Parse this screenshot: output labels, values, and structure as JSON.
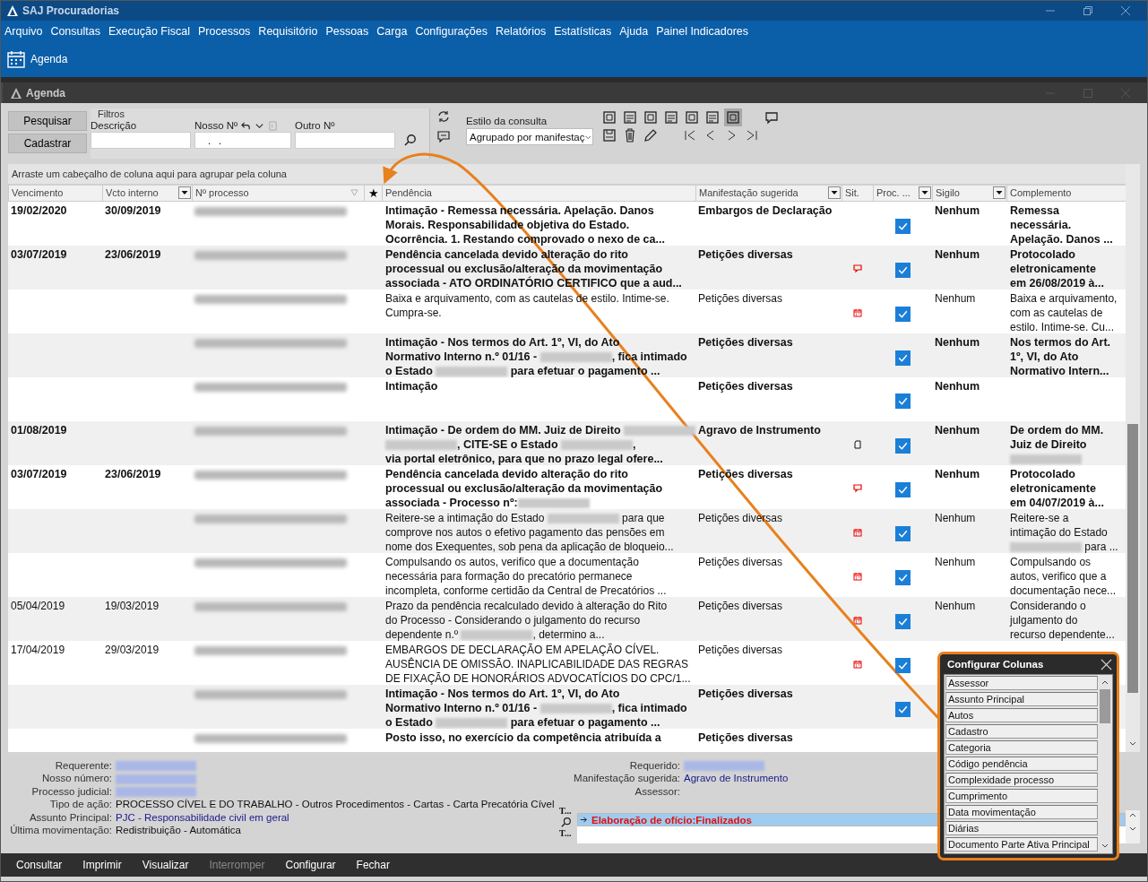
{
  "app": {
    "title": "SAJ Procuradorias"
  },
  "menu": [
    "Arquivo",
    "Consultas",
    "Execução Fiscal",
    "Processos",
    "Requisitório",
    "Pessoas",
    "Carga",
    "Configurações",
    "Relatórios",
    "Estatísticas",
    "Ajuda",
    "Painel Indicadores"
  ],
  "ribbon": [
    {
      "label": "Agenda"
    }
  ],
  "window": {
    "title": "Agenda"
  },
  "filters": {
    "buttons": [
      "Pesquisar",
      "Cadastrar"
    ],
    "group_label": "Filtros",
    "fields": [
      {
        "label": "Descrição"
      },
      {
        "label": "Nosso Nº",
        "value": ". ."
      },
      {
        "label": "Outro Nº"
      }
    ],
    "style_label": "Estilo da consulta",
    "style_value": "Agrupado por manifestaç"
  },
  "table": {
    "group_hint": "Arraste um cabeçalho de coluna aqui para agrupar pela coluna",
    "columns": [
      {
        "label": "Vencimento",
        "kind": "plain"
      },
      {
        "label": "Vcto interno",
        "kind": "dropdown"
      },
      {
        "label": "Nº processo",
        "kind": "filter"
      },
      {
        "label": "★",
        "kind": "plain"
      },
      {
        "label": "Pendência",
        "kind": "plain"
      },
      {
        "label": "Manifestação sugerida",
        "kind": "dropdown"
      },
      {
        "label": "Sit.",
        "kind": "plain"
      },
      {
        "label": "Proc. ...",
        "kind": "dropdown"
      },
      {
        "label": "Sigilo",
        "kind": "dropdown"
      },
      {
        "label": "Complemento",
        "kind": "plain"
      }
    ],
    "rows": [
      {
        "due": "19/02/2020",
        "internal": "30/09/2019",
        "bold": true,
        "pendencia": [
          [
            "Intimação - Remessa necessária. Apelação. Danos"
          ],
          [
            "Morais. Responsabilidade objetiva do Estado."
          ],
          [
            "Ocorrência. 1. Restando comprovado o nexo de ca..."
          ]
        ],
        "manifestacao": "Embargos de Declaração",
        "proc": true,
        "sigilo": "Nenhum",
        "complemento": [
          [
            "Remessa"
          ],
          [
            "necessária."
          ],
          [
            "Apelação. Danos ..."
          ]
        ]
      },
      {
        "due": "03/07/2019",
        "internal": "23/06/2019",
        "bold": true,
        "pendencia": [
          [
            "Pendência cancelada devido alteração do rito"
          ],
          [
            "processual ou exclusão/alteração da movimentação"
          ],
          [
            "associada - ATO ORDINATÓRIO CERTIFICO que a aud..."
          ]
        ],
        "manifestacao": "Petições diversas",
        "sit": {
          "kind": "comment"
        },
        "proc": true,
        "sigilo": "Nenhum",
        "complemento": [
          [
            "Protocolado"
          ],
          [
            "eletronicamente"
          ],
          [
            "em 26/08/2019 à..."
          ]
        ]
      },
      {
        "bold": false,
        "pendencia": [
          [
            "Baixa e arquivamento, com as cautelas de estilo. Intime-se."
          ],
          [
            "Cumpra-se."
          ]
        ],
        "manifestacao": "Petições diversas",
        "sit": {
          "kind": "calendar"
        },
        "proc": true,
        "sigilo": "Nenhum",
        "complemento": [
          [
            "Baixa e arquivamento,"
          ],
          [
            "com as cautelas de"
          ],
          [
            "estilo. Intime-se. Cu..."
          ]
        ]
      },
      {
        "bold": true,
        "pendencia": [
          [
            "Intimação - Nos termos do Art. 1º, VI, do Ato"
          ],
          [
            "Normativo Interno n.º 01/16 - ",
            {
              "kind": "redacted"
            },
            ", fica intimado"
          ],
          [
            "o Estado ",
            {
              "kind": "redacted"
            },
            " para efetuar o pagamento ..."
          ]
        ],
        "manifestacao": "Petições diversas",
        "proc": true,
        "sigilo": "Nenhum",
        "complemento": [
          [
            "Nos termos do Art."
          ],
          [
            "1º, VI, do Ato"
          ],
          [
            "Normativo Intern..."
          ]
        ]
      },
      {
        "bold": true,
        "pendencia": [
          [
            "Intimação"
          ]
        ],
        "manifestacao": "Petições diversas",
        "proc": true,
        "sigilo": "Nenhum"
      },
      {
        "due": "01/08/2019",
        "bold": true,
        "pendencia": [
          [
            "Intimação - De ordem do MM. Juiz de Direito ",
            {
              "kind": "redacted"
            }
          ],
          [
            {
              "kind": "redacted"
            },
            ", CITE-SE o Estado ",
            {
              "kind": "redacted"
            },
            ","
          ],
          [
            "via portal eletrônico, para que no prazo legal ofere..."
          ]
        ],
        "manifestacao": "Agravo de Instrumento",
        "sit": {
          "kind": "document"
        },
        "proc": true,
        "sigilo": "Nenhum",
        "complemento": [
          [
            "De ordem do MM."
          ],
          [
            "Juiz de Direito"
          ],
          [
            {
              "kind": "redacted"
            }
          ]
        ]
      },
      {
        "due": "03/07/2019",
        "internal": "23/06/2019",
        "bold": true,
        "pendencia": [
          [
            "Pendência cancelada devido alteração do rito"
          ],
          [
            "processual ou exclusão/alteração da movimentação"
          ],
          [
            "associada - Processo nº:",
            {
              "kind": "redacted"
            }
          ]
        ],
        "manifestacao": "Petições diversas",
        "sit": {
          "kind": "comment"
        },
        "proc": true,
        "sigilo": "Nenhum",
        "complemento": [
          [
            "Protocolado"
          ],
          [
            "eletronicamente"
          ],
          [
            "em 04/07/2019 à..."
          ]
        ]
      },
      {
        "bold": false,
        "pendencia": [
          [
            "Reitere-se a intimação do Estado ",
            {
              "kind": "redacted"
            },
            " para que"
          ],
          [
            "comprove nos autos o efetivo pagamento das pensões em"
          ],
          [
            "nome dos Exequentes, sob pena da aplicação de bloqueio..."
          ]
        ],
        "manifestacao": "Petições diversas",
        "sit": {
          "kind": "calendar"
        },
        "proc": true,
        "sigilo": "Nenhum",
        "complemento": [
          [
            "Reitere-se a"
          ],
          [
            "intimação do Estado"
          ],
          [
            {
              "kind": "redacted"
            },
            " para ..."
          ]
        ]
      },
      {
        "bold": false,
        "pendencia": [
          [
            "Compulsando os autos, verifico que a documentação"
          ],
          [
            "necessária para formação do precatório permanece"
          ],
          [
            "incompleta, conforme certidão da Central de Precatórios ..."
          ]
        ],
        "manifestacao": "Petições diversas",
        "sit": {
          "kind": "calendar"
        },
        "proc": true,
        "sigilo": "Nenhum",
        "complemento": [
          [
            "Compulsando os"
          ],
          [
            "autos, verifico que a"
          ],
          [
            "documentação nece..."
          ]
        ]
      },
      {
        "due": "05/04/2019",
        "internal": "19/03/2019",
        "bold": false,
        "pendencia": [
          [
            "Prazo da pendência recalculado devido à alteração do Rito"
          ],
          [
            "do Processo - Considerando o julgamento do recurso"
          ],
          [
            "dependente n.º ",
            {
              "kind": "redacted"
            },
            ", determino a..."
          ]
        ],
        "manifestacao": "Petições diversas",
        "sit": {
          "kind": "calendar"
        },
        "proc": true,
        "sigilo": "Nenhum",
        "complemento": [
          [
            "Considerando o"
          ],
          [
            "julgamento do"
          ],
          [
            "recurso dependente..."
          ]
        ]
      },
      {
        "due": "17/04/2019",
        "internal": "29/03/2019",
        "bold": false,
        "pendencia": [
          [
            "EMBARGOS DE DECLARAÇÃO EM APELAÇÃO CÍVEL."
          ],
          [
            "AUSÊNCIA DE OMISSÃO. INAPLICABILIDADE DAS REGRAS"
          ],
          [
            "DE FIXAÇÃO DE HONORÁRIOS ADVOCATÍCIOS DO CPC/1..."
          ]
        ],
        "manifestacao": "Petições diversas",
        "sit": {
          "kind": "calendar"
        },
        "proc": true
      },
      {
        "bold": true,
        "pendencia": [
          [
            "Intimação - Nos termos do Art. 1º, VI, do Ato"
          ],
          [
            "Normativo Interno n.º 01/16 - ",
            {
              "kind": "redacted"
            },
            ", fica intimado"
          ],
          [
            "o Estado ",
            {
              "kind": "redacted"
            },
            " para efetuar o pagamento ..."
          ]
        ],
        "manifestacao": "Petições diversas",
        "proc": true
      },
      {
        "bold": true,
        "pendencia": [
          [
            "Posto isso, no exercício da competência atribuída a"
          ]
        ],
        "manifestacao": "Petições diversas"
      }
    ]
  },
  "details": {
    "left": [
      {
        "label": "Requerente:",
        "kind": "redacted"
      },
      {
        "label": "Nosso número:",
        "kind": "redacted"
      },
      {
        "label": "Processo judicial:",
        "kind": "redacted"
      },
      {
        "label": "Tipo de ação:",
        "kind": "text",
        "value": "PROCESSO CÍVEL E DO TRABALHO - Outros Procedimentos - Cartas - Carta Precatória Cível"
      },
      {
        "label": "Assunto Principal:",
        "kind": "link",
        "value": "PJC - Responsabilidade civil em geral"
      },
      {
        "label": "Última movimentação:",
        "kind": "text",
        "value": "Redistribuição - Automática"
      }
    ],
    "right": [
      {
        "label": "Requerido:",
        "kind": "redacted"
      },
      {
        "label": "Manifestação sugerida:",
        "kind": "link",
        "value": "Agravo de Instrumento"
      },
      {
        "label": "Assessor:",
        "kind": "empty"
      }
    ],
    "movement_labels": [
      "T...",
      "T..."
    ],
    "movements": [
      {
        "text": "Elaboração de ofício:Finalizados",
        "selected": true
      }
    ]
  },
  "footer": [
    {
      "label": "Consultar",
      "disabled": false
    },
    {
      "label": "Imprimir",
      "disabled": false
    },
    {
      "label": "Visualizar",
      "disabled": false
    },
    {
      "label": "Interromper",
      "disabled": true
    },
    {
      "label": "Configurar",
      "disabled": false
    },
    {
      "label": "Fechar",
      "disabled": false
    }
  ],
  "popup": {
    "title": "Configurar Colunas",
    "items": [
      "Assessor",
      "Assunto Principal",
      "Autos",
      "Cadastro",
      "Categoria",
      "Código pendência",
      "Complexidade processo",
      "Cumprimento",
      "Data movimentação",
      "Diárias",
      "Documento Parte Ativa Principal"
    ]
  }
}
